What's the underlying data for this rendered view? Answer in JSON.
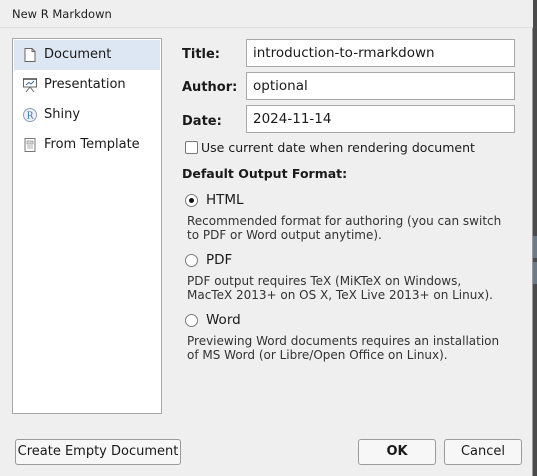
{
  "window": {
    "title": "New R Markdown"
  },
  "sidebar": {
    "items": [
      {
        "label": "Document",
        "icon": "document-icon"
      },
      {
        "label": "Presentation",
        "icon": "presentation-icon"
      },
      {
        "label": "Shiny",
        "icon": "shiny-r-icon"
      },
      {
        "label": "From Template",
        "icon": "template-icon"
      }
    ],
    "selected": "Document"
  },
  "form": {
    "title_label": "Title:",
    "title_value": "introduction-to-rmarkdown",
    "author_label": "Author:",
    "author_value": "optional",
    "date_label": "Date:",
    "date_value": "2024-11-14",
    "use_current_date_label": "Use current date when rendering document",
    "use_current_date_checked": false
  },
  "output": {
    "section_title": "Default Output Format:",
    "options": [
      {
        "label": "HTML",
        "selected": true,
        "desc1": "Recommended format for authoring (you can switch",
        "desc2": "to PDF or Word output anytime)."
      },
      {
        "label": "PDF",
        "selected": false,
        "desc1": "PDF output requires TeX (MiKTeX on Windows,",
        "desc2": "MacTeX 2013+ on OS X, TeX Live 2013+ on Linux)."
      },
      {
        "label": "Word",
        "selected": false,
        "desc1": "Previewing Word documents requires an installation",
        "desc2": "of MS Word (or Libre/Open Office on Linux)."
      }
    ]
  },
  "buttons": {
    "create_empty": "Create Empty Document",
    "ok": "OK",
    "cancel": "Cancel"
  }
}
